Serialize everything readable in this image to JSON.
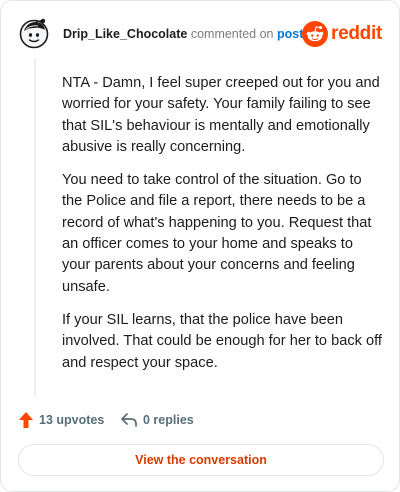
{
  "comment": {
    "username": "Drip_Like_Chocolate",
    "action_text": "commented on",
    "target_link": "post",
    "avatar_icon": "snoo-avatar-icon"
  },
  "brand": {
    "logo_text": "reddit",
    "logo_icon": "reddit-snoo-icon",
    "accent_color": "#ff4500"
  },
  "body": {
    "paragraphs": [
      "NTA - Damn, I feel super creeped out for you and worried for your safety. Your family failing to see that SIL's behaviour is mentally and emotionally abusive is really concerning.",
      "You need to take control of the situation. Go to the Police and file a report, there needs to be a record of what's happening to you. Request that an officer comes to your home and speaks to your parents about your concerns and feeling unsafe.",
      "If your SIL learns, that the police have been involved. That could be enough for her to back off and respect your space."
    ]
  },
  "footer": {
    "upvotes_label": "13 upvotes",
    "upvote_icon": "upvote-arrow-icon",
    "replies_label": "0 replies",
    "reply_icon": "reply-arrow-icon",
    "cta_label": "View the conversation"
  }
}
